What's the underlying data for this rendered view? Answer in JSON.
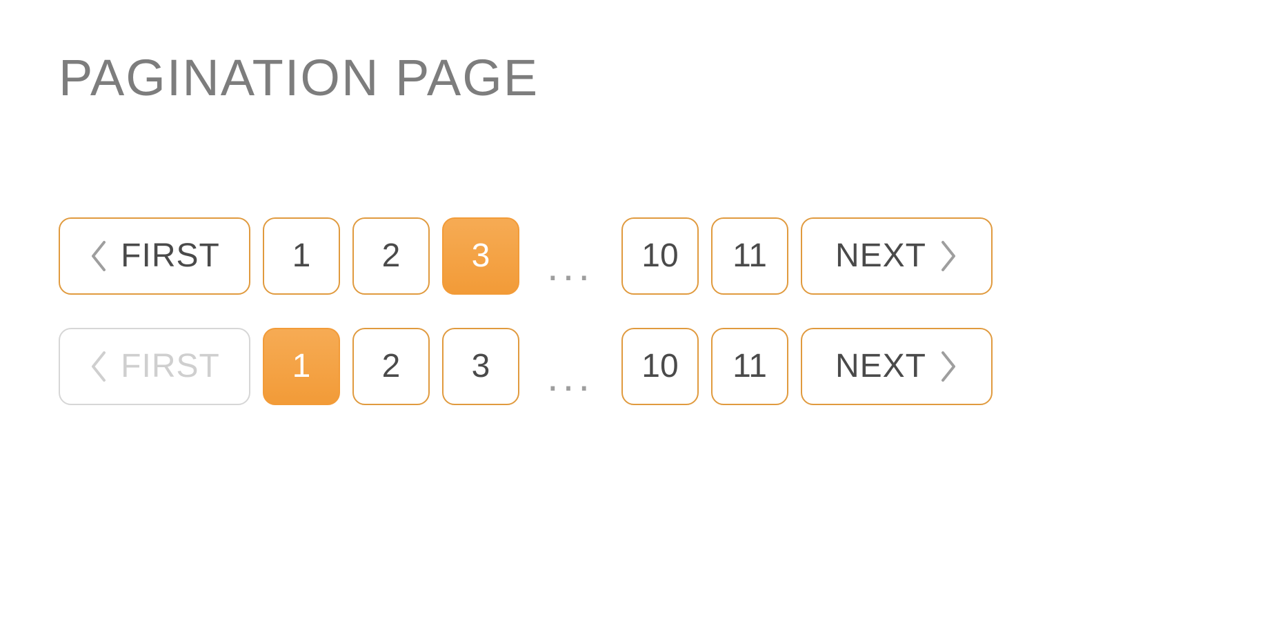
{
  "title": "PAGINATION PAGE",
  "colors": {
    "accent": "#f29b38",
    "border": "#e09a3e",
    "text": "#4a4a4a",
    "muted": "#9e9e9e",
    "disabled": "#cfcfcf"
  },
  "rows": [
    {
      "first": {
        "label": "FIRST",
        "disabled": false
      },
      "next": {
        "label": "NEXT",
        "disabled": false
      },
      "ellipsis": "...",
      "active_index": 2,
      "pages_left": [
        "1",
        "2",
        "3"
      ],
      "pages_right": [
        "10",
        "11"
      ]
    },
    {
      "first": {
        "label": "FIRST",
        "disabled": true
      },
      "next": {
        "label": "NEXT",
        "disabled": false
      },
      "ellipsis": "...",
      "active_index": 0,
      "pages_left": [
        "1",
        "2",
        "3"
      ],
      "pages_right": [
        "10",
        "11"
      ]
    }
  ]
}
